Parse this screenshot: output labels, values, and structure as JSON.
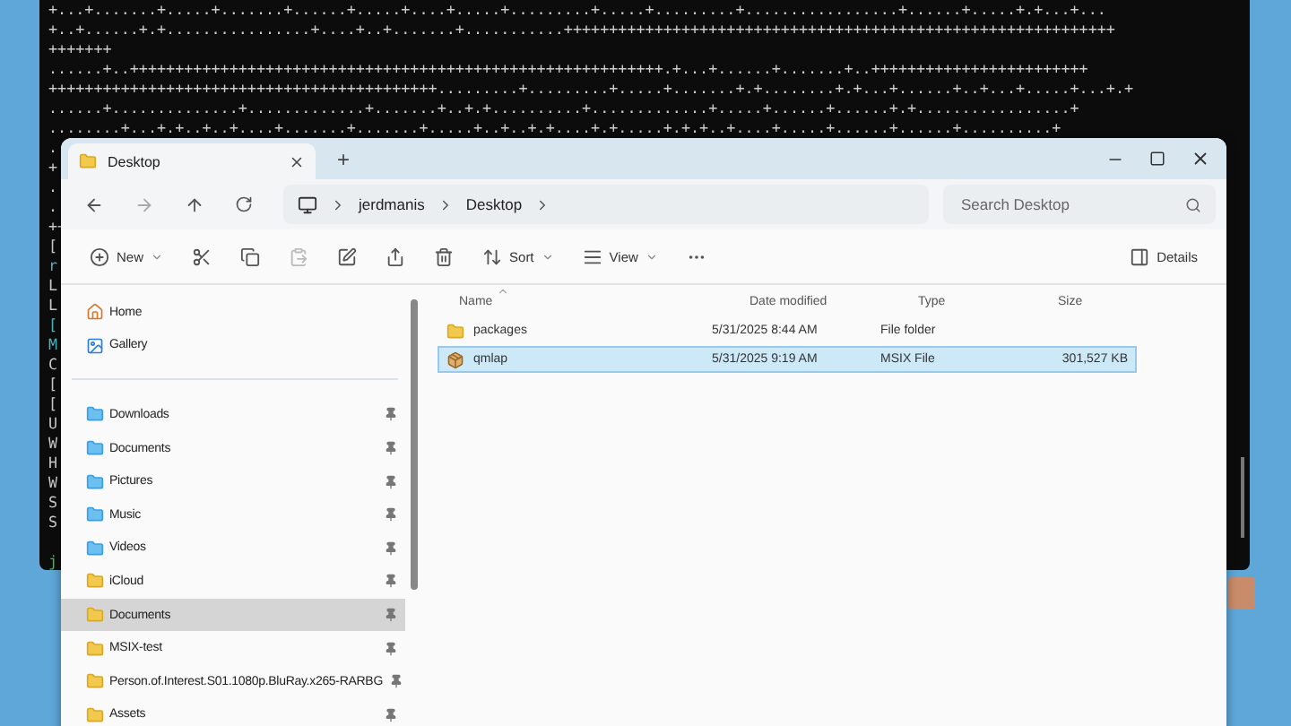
{
  "terminal": {
    "lines": [
      "+...+.......+.....+.......+......+.....+....+.....+.........+.....+.........+.................+......+.....+.+...+...",
      "+..+......+.+................+....+..+.......+...........+++++++++++++++++++++++++++++++++++++++++++++++++++++++++++++",
      "+++++++",
      "......+..+++++++++++++++++++++++++++++++++++++++++++++++++++++++++++.+...+......+.......+..++++++++++++++++++++++++",
      "+++++++++++++++++++++++++++++++++++++++++++.........+.........+.....+.......+.+........+.+...+......+..+...+.....+...+.+",
      "......+..............+.............+.......+..+.+..........+.............+.....+......+......+.+.................+",
      "........+...+.+..+..+....+.......+.......+.....+..+..+.+....+.+.....+.+.+..+....+.....+......+......+..........+",
      ".",
      "+",
      ".",
      ".",
      "++",
      "[",
      "r",
      "L",
      "L",
      "[",
      "M",
      "C",
      "[",
      "[",
      "U",
      "W",
      "H",
      "W",
      "S",
      "S"
    ],
    "prompt": "j"
  },
  "explorer": {
    "tabs": [
      {
        "label": "Desktop",
        "selected": true
      }
    ],
    "new_tab": "+",
    "breadcrumb": [
      "jerdmanis",
      "Desktop"
    ],
    "search": {
      "placeholder": "Search Desktop"
    },
    "toolbar": [
      {
        "kind": "new",
        "label": "New",
        "disabled": false
      },
      {
        "kind": "cut",
        "disabled": false
      },
      {
        "kind": "copy",
        "disabled": false
      },
      {
        "kind": "paste",
        "disabled": true
      },
      {
        "kind": "rename",
        "disabled": false
      },
      {
        "kind": "share",
        "disabled": false
      },
      {
        "kind": "delete",
        "disabled": false
      },
      {
        "kind": "sort",
        "label": "Sort",
        "disabled": false
      },
      {
        "kind": "view",
        "label": "View",
        "disabled": false
      },
      {
        "kind": "more",
        "disabled": false
      }
    ],
    "details_button": "Details",
    "sidebar": {
      "top": [
        {
          "kind": "home",
          "label": "Home",
          "pinned": false,
          "selected": false
        },
        {
          "kind": "gallery",
          "label": "Gallery",
          "pinned": false,
          "selected": false
        }
      ],
      "quick_access": [
        {
          "kind": "system",
          "label": "Downloads",
          "pinned": true,
          "selected": false
        },
        {
          "kind": "system",
          "label": "Documents",
          "pinned": true,
          "selected": false
        },
        {
          "kind": "system",
          "label": "Pictures",
          "pinned": true,
          "selected": false
        },
        {
          "kind": "system",
          "label": "Music",
          "pinned": true,
          "selected": false
        },
        {
          "kind": "system",
          "label": "Videos",
          "pinned": true,
          "selected": false
        },
        {
          "kind": "cloud",
          "label": "iCloud",
          "pinned": true,
          "selected": false
        },
        {
          "kind": "folder",
          "label": "Documents",
          "pinned": true,
          "selected": true
        },
        {
          "kind": "folder",
          "label": "MSIX-test",
          "pinned": true,
          "selected": false
        },
        {
          "kind": "folder",
          "label": "Person.of.Interest.S01.1080p.BluRay.x265-RARBG",
          "pinned": true,
          "selected": false
        },
        {
          "kind": "folder",
          "label": "Assets",
          "pinned": true,
          "selected": false
        }
      ]
    },
    "columns": [
      "Name",
      "Date modified",
      "Type",
      "Size"
    ],
    "rows": [
      {
        "kind": "folder",
        "name": "packages",
        "date": "5/31/2025 8:44 AM",
        "type": "File folder",
        "selected": false
      },
      {
        "kind": "package",
        "name": "qmlap",
        "date": "5/31/2025 9:19 AM",
        "type": "MSIX File",
        "size": "301,527 KB",
        "selected": true
      }
    ]
  }
}
